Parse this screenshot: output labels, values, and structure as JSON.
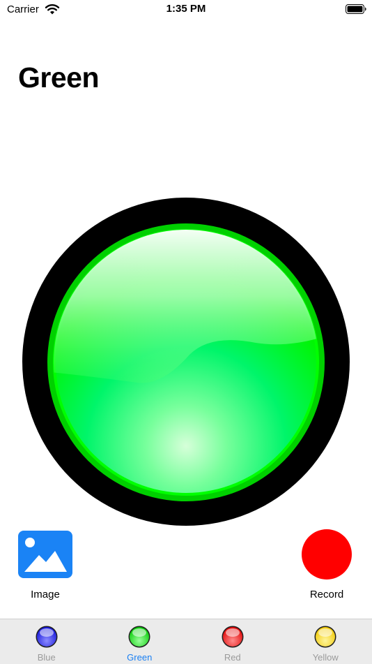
{
  "status_bar": {
    "carrier": "Carrier",
    "time": "1:35 PM"
  },
  "page": {
    "title": "Green"
  },
  "main_button": {
    "color": "#00f000",
    "ring_color": "#000000"
  },
  "actions": {
    "image_label": "Image",
    "record_label": "Record",
    "image_color": "#1a83f5",
    "record_color": "#ff0000"
  },
  "tabs": [
    {
      "label": "Blue",
      "color": "#2b2bff",
      "active": false
    },
    {
      "label": "Green",
      "color": "#00e000",
      "active": true
    },
    {
      "label": "Red",
      "color": "#ff0000",
      "active": false
    },
    {
      "label": "Yellow",
      "color": "#ffe000",
      "active": false
    }
  ]
}
